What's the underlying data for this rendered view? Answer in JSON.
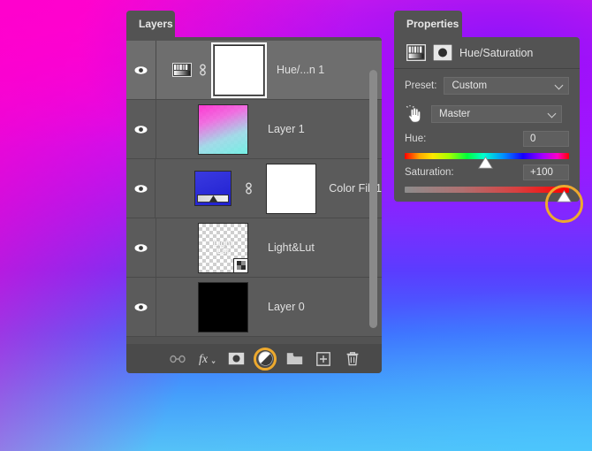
{
  "background": {
    "description": "magenta-to-blue gradient canvas",
    "colors": [
      "#ff18e2",
      "#b916ff",
      "#5b3cff",
      "#3e6cff",
      "#55c2f8"
    ]
  },
  "accent_color": "#eda92e",
  "layers_panel": {
    "tab_label": "Layers",
    "layers": [
      {
        "name": "Hue/...n 1",
        "visible": true,
        "selected": true,
        "thumb_type": "adjustment-mask",
        "has_link": true,
        "mask_selected": true,
        "adjustment_icon": "hue-saturation-icon"
      },
      {
        "name": "Layer 1",
        "visible": true,
        "selected": false,
        "thumb_type": "gradient-pink-cyan",
        "has_link": false,
        "mask_selected": false
      },
      {
        "name": "Color Fill 1",
        "visible": true,
        "selected": false,
        "thumb_type": "color-fill",
        "has_link": true,
        "mask_selected": false
      },
      {
        "name": "Light&Lut",
        "visible": true,
        "selected": false,
        "thumb_type": "smart-object-transparent",
        "thumb_text_line1": "Light",
        "thumb_text_line2": "Lut",
        "has_link": false,
        "mask_selected": false
      },
      {
        "name": "Layer 0",
        "visible": true,
        "selected": false,
        "thumb_type": "black",
        "has_link": false,
        "mask_selected": false
      }
    ],
    "toolbar": [
      {
        "name": "link-layers-icon",
        "label": "Link layers",
        "highlighted": false
      },
      {
        "name": "layer-style-fx-icon",
        "label": "fx",
        "highlighted": false
      },
      {
        "name": "add-layer-mask-icon",
        "label": "Add layer mask",
        "highlighted": false
      },
      {
        "name": "new-adjustment-layer-icon",
        "label": "New adjustment layer",
        "highlighted": true
      },
      {
        "name": "new-group-icon",
        "label": "New group",
        "highlighted": false
      },
      {
        "name": "new-layer-icon",
        "label": "New layer",
        "highlighted": false
      },
      {
        "name": "delete-layer-icon",
        "label": "Delete layer",
        "highlighted": false
      }
    ]
  },
  "properties_panel": {
    "tab_label": "Properties",
    "title": "Hue/Saturation",
    "preset_label": "Preset:",
    "preset_value": "Custom",
    "channel_value": "Master",
    "hue": {
      "label": "Hue:",
      "value": "0",
      "thumb_percent": 49,
      "highlighted": false
    },
    "saturation": {
      "label": "Saturation:",
      "value": "+100",
      "thumb_percent": 97,
      "highlighted": true
    }
  }
}
